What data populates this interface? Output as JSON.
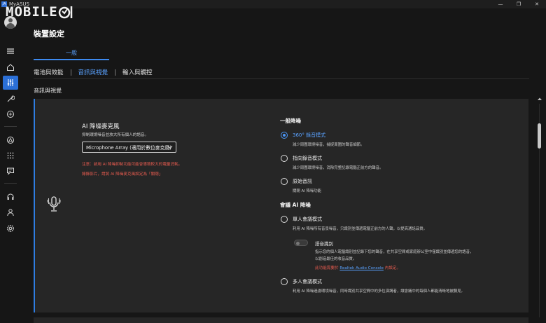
{
  "titlebar": {
    "badge": "/A",
    "title": "MyASUS",
    "minimize": "—",
    "maximize": "❐",
    "close": "✕"
  },
  "watermark": {
    "text": "MOBILE"
  },
  "page": {
    "title": "裝置設定"
  },
  "main_tab": {
    "label": "一般"
  },
  "subtabs": [
    "電池與效能",
    "音訊與視覺",
    "輸入與觸控"
  ],
  "section": {
    "title": "音訊與視覺"
  },
  "ai_noise_mic": {
    "title": "AI 降噪麥克風",
    "desc": "抑制環境噪音並放大所有個人的語音。",
    "dropdown_value": "Microphone Array (適用於數位麥克風)",
    "warning_1": "注意：啟用 AI 降噪抑制功能可能會導致較大的電量消耗。",
    "warning_2": "錄錄影片，請將 AI 降噪麥克風設定為「關閉」"
  },
  "general_nr": {
    "title": "一般降噪",
    "options": [
      {
        "label": "360° 錄音模式",
        "desc": "減少周圍環境噪音，捕捉周圍的聲音細節。"
      },
      {
        "label": "指向錄音模式",
        "desc": "減少周圍環境噪音，消除完整記錄電腦正前方的聲音。"
      },
      {
        "label": "原始音訊",
        "desc": "關閉 AI 降噪功能"
      }
    ]
  },
  "meeting_nr": {
    "title": "會議 AI 降噪",
    "single": {
      "label": "單人會議模式",
      "desc": "利用 AI 降噪所有音景噪音，只識別並傳遞電腦正前方的人聲，以提高通話品質。"
    },
    "voice_id": {
      "label": "語音識別",
      "desc_1": "指示您的個人電腦識別並記錄下您的聲音，在共享空間或家庭辦公室中僅識別並傳遞您的語音，",
      "desc_2": "以創造最佳的收音品質。",
      "note_prefix": "此功能需要於",
      "note_link": "Realtek Audio Console",
      "note_suffix": "內設定。"
    },
    "multi": {
      "label": "多人會議模式",
      "desc": "利用 AI 降噪過濾環境噪音，同時識別共享空間中的多位演講者，讓會議中的每個人都能清晰地被聽見。"
    }
  },
  "colors": {
    "accent": "#3d8af0",
    "warning": "#e65b4f",
    "background": "#161616",
    "card": "#262626"
  }
}
